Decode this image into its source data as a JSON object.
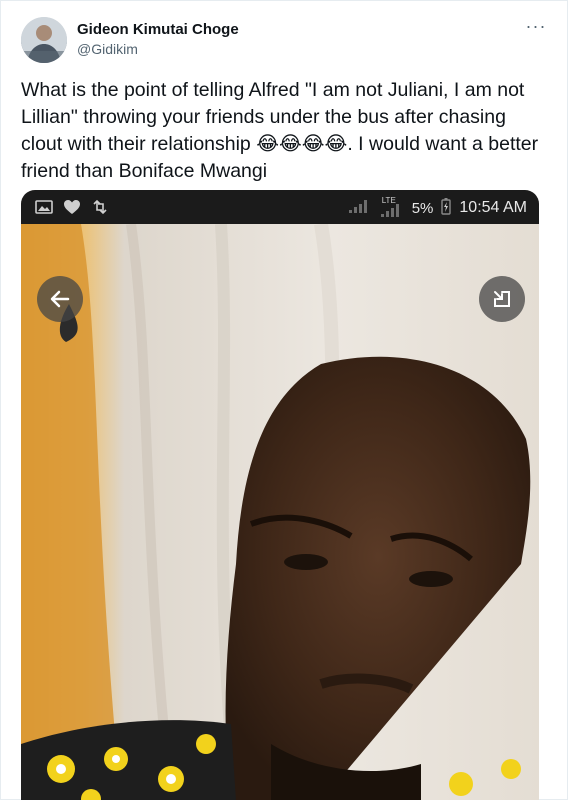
{
  "tweet": {
    "author_name": "Gideon Kimutai Choge",
    "author_handle": "@Gidikim",
    "more_icon": "more-dots-icon",
    "more_label": "···",
    "text": "What is the point of telling Alfred \"I am not Juliani, I am not Lillian\" throwing your friends under the bus after chasing clout with their relationship 😂😂😂😂. I would want a better friend than Boniface Mwangi"
  },
  "media": {
    "status_bar": {
      "left_icons": [
        "image-icon",
        "heart-icon",
        "retweet-icon"
      ],
      "network_label": "LTE",
      "battery": "5%",
      "time": "10:54 AM"
    },
    "controls": {
      "back_icon": "arrow-left-icon",
      "expand_icon": "exit-fullscreen-icon"
    }
  },
  "colors": {
    "text_primary": "#0f1419",
    "text_secondary": "#536471",
    "status_bar_bg": "#1b1b1b"
  }
}
